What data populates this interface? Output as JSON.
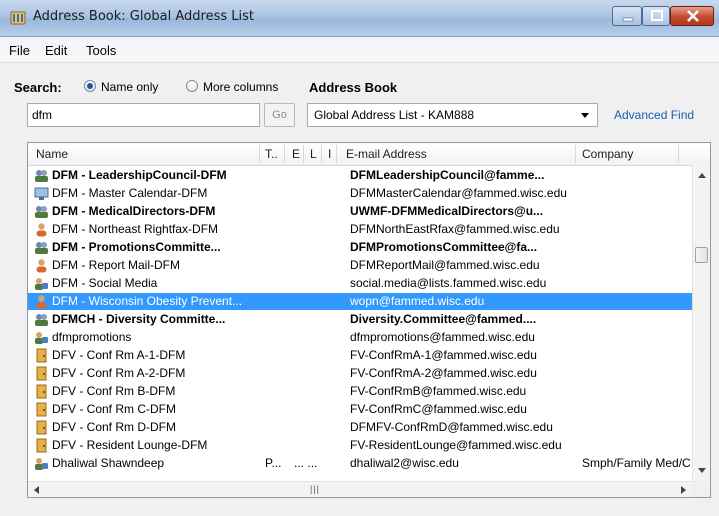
{
  "window": {
    "title": "Address Book: Global Address List"
  },
  "menu": [
    "File",
    "Edit",
    "Tools"
  ],
  "search": {
    "label": "Search:",
    "option_name_only": "Name only",
    "option_more_columns": "More columns",
    "selected": "Name only",
    "value": "dfm",
    "go_label": "Go"
  },
  "address_book": {
    "label": "Address Book",
    "selected": "Global Address List - KAM888",
    "advanced_find": "Advanced Find"
  },
  "columns": {
    "name": "Name",
    "title": "T..",
    "e": "E",
    "l": "L",
    "i": "I",
    "email": "E-mail Address",
    "company": "Company"
  },
  "rows": [
    {
      "icon": "group-icon",
      "name": "DFM - LeadershipCouncil-DFM",
      "email": "DFMLeadershipCouncil@famme...",
      "bold": true
    },
    {
      "icon": "room-icon",
      "name": "DFM - Master Calendar-DFM",
      "email": "DFMMasterCalendar@fammed.wisc.edu"
    },
    {
      "icon": "group-icon",
      "name": "DFM - MedicalDirectors-DFM",
      "email": "UWMF-DFMMedicalDirectors@u...",
      "bold": true
    },
    {
      "icon": "user-icon",
      "name": "DFM - Northeast Rightfax-DFM",
      "email": "DFMNorthEastRfax@fammed.wisc.edu"
    },
    {
      "icon": "group-icon",
      "name": "DFM - PromotionsCommitte...",
      "email": "DFMPromotionsCommittee@fa...",
      "bold": true
    },
    {
      "icon": "user-icon",
      "name": "DFM - Report Mail-DFM",
      "email": "DFMReportMail@fammed.wisc.edu"
    },
    {
      "icon": "contact-icon",
      "name": "DFM - Social Media",
      "email": "social.media@lists.fammed.wisc.edu"
    },
    {
      "icon": "user-icon",
      "name": "DFM - Wisconsin Obesity Prevent...",
      "email": "wopn@fammed.wisc.edu",
      "selected": true
    },
    {
      "icon": "group-icon",
      "name": "DFMCH - Diversity Committe...",
      "email": "Diversity.Committee@fammed....",
      "bold": true
    },
    {
      "icon": "contact-icon",
      "name": "dfmpromotions",
      "email": "dfmpromotions@fammed.wisc.edu"
    },
    {
      "icon": "resource-icon",
      "name": "DFV - Conf Rm A-1-DFM",
      "email": "FV-ConfRmA-1@fammed.wisc.edu"
    },
    {
      "icon": "resource-icon",
      "name": "DFV - Conf Rm A-2-DFM",
      "email": "FV-ConfRmA-2@fammed.wisc.edu"
    },
    {
      "icon": "resource-icon",
      "name": "DFV - Conf Rm B-DFM",
      "email": "FV-ConfRmB@fammed.wisc.edu"
    },
    {
      "icon": "resource-icon",
      "name": "DFV - Conf Rm C-DFM",
      "email": "FV-ConfRmC@fammed.wisc.edu"
    },
    {
      "icon": "resource-icon",
      "name": "DFV - Conf Rm D-DFM",
      "email": "DFMFV-ConfRmD@fammed.wisc.edu"
    },
    {
      "icon": "resource-icon",
      "name": "DFV - Resident Lounge-DFM",
      "email": "FV-ResidentLounge@fammed.wisc.edu"
    },
    {
      "icon": "contact-icon",
      "name": "Dhaliwal Shawndeep",
      "title": "P...",
      "e": "...",
      "l": "...",
      "email": "dhaliwal2@wisc.edu",
      "company": "Smph/Family Med/C"
    }
  ],
  "colors": {
    "selection": "#3399ff",
    "link": "#1a5fb4",
    "close_button": "#c54a2f"
  }
}
